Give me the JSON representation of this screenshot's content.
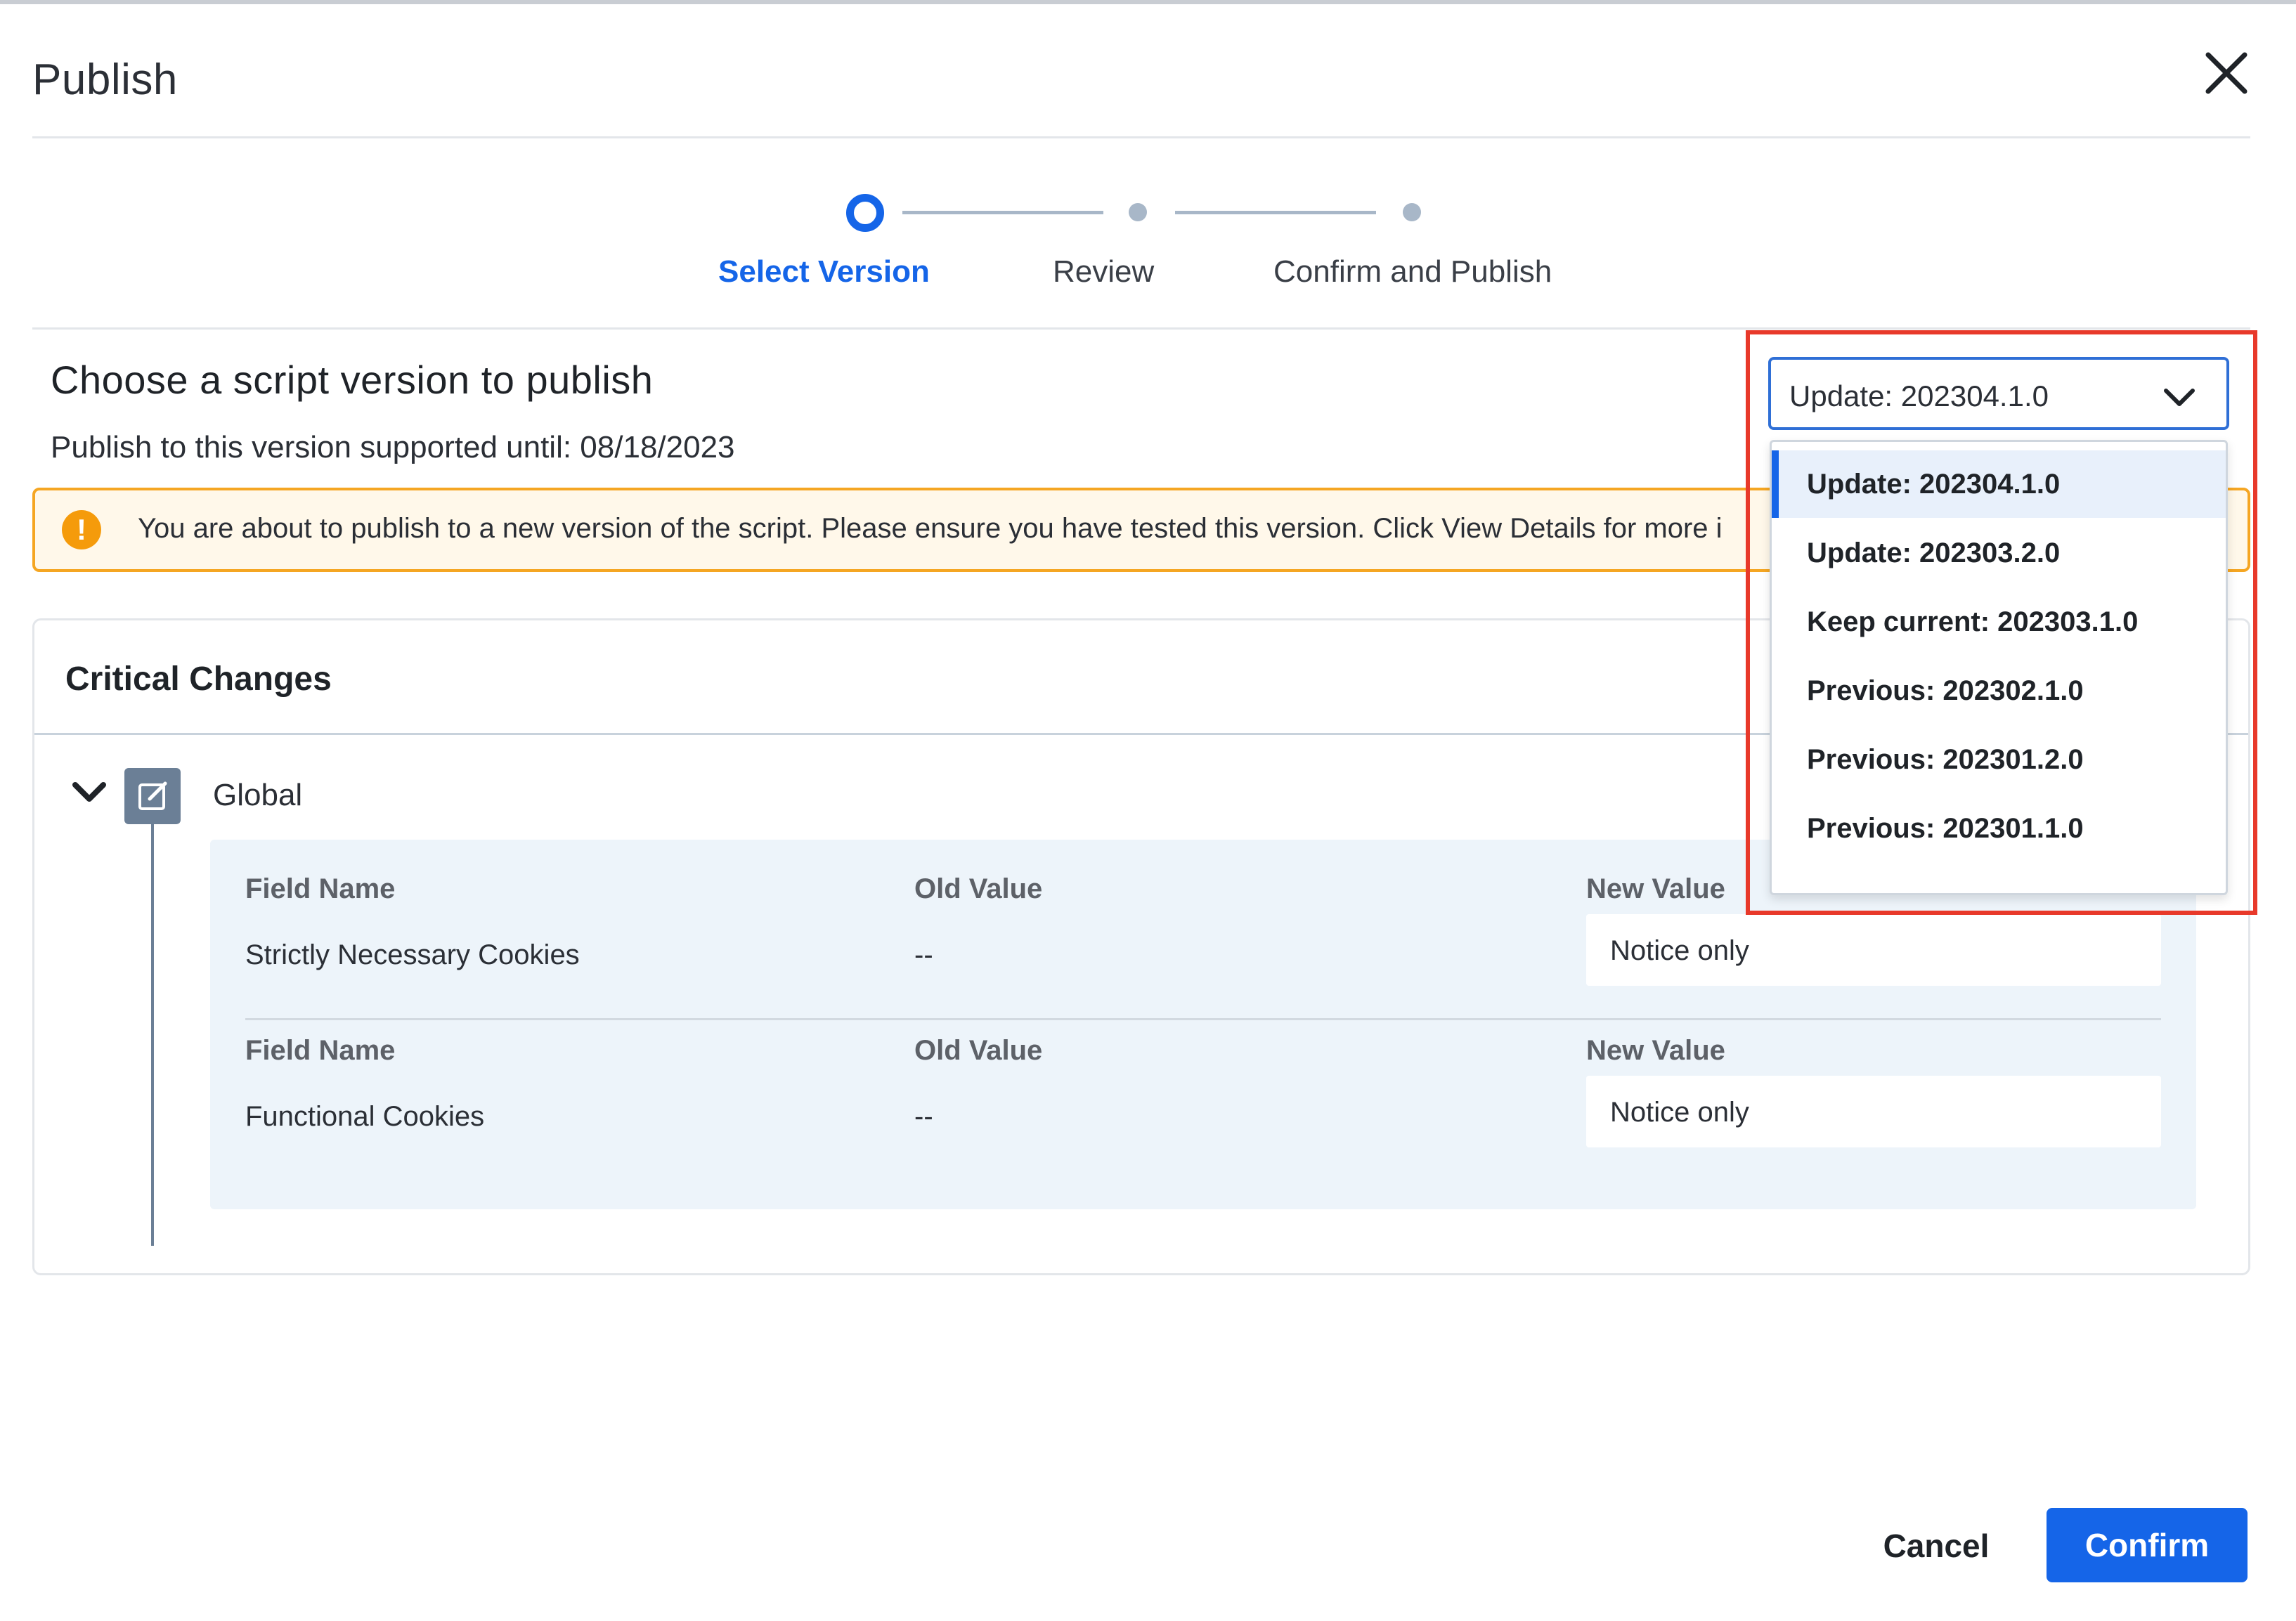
{
  "dialog": {
    "title": "Publish",
    "close_icon": "close-icon"
  },
  "stepper": {
    "steps": [
      {
        "label": "Select Version",
        "state": "active"
      },
      {
        "label": "Review",
        "state": "pending"
      },
      {
        "label": "Confirm and Publish",
        "state": "pending"
      }
    ]
  },
  "version_section": {
    "title": "Choose a script version to publish",
    "subtitle": "Publish to this version supported until: 08/18/2023"
  },
  "warning": {
    "icon": "exclamation-icon",
    "text": "You are about to publish to a new version of the script. Please ensure you have tested this version. Click View Details for more i"
  },
  "version_select": {
    "value": "Update: 202304.1.0",
    "options": [
      "Update: 202304.1.0",
      "Update: 202303.2.0",
      "Keep current: 202303.1.0",
      "Previous: 202302.1.0",
      "Previous: 202301.2.0",
      "Previous: 202301.1.0"
    ],
    "selected_index": 0
  },
  "critical_changes": {
    "title": "Critical Changes",
    "group": {
      "label": "Global",
      "rows": [
        {
          "field_name_header": "Field Name",
          "old_value_header": "Old Value",
          "new_value_header": "New Value",
          "field_name": "Strictly Necessary Cookies",
          "old_value": "--",
          "new_value": "Notice only"
        },
        {
          "field_name_header": "Field Name",
          "old_value_header": "Old Value",
          "new_value_header": "New Value",
          "field_name": "Functional Cookies",
          "old_value": "--",
          "new_value": "Notice only"
        }
      ]
    }
  },
  "footer": {
    "cancel_label": "Cancel",
    "confirm_label": "Confirm"
  },
  "colors": {
    "primary": "#1565e8",
    "warning": "#f59b0b",
    "highlight": "#e8392a"
  }
}
